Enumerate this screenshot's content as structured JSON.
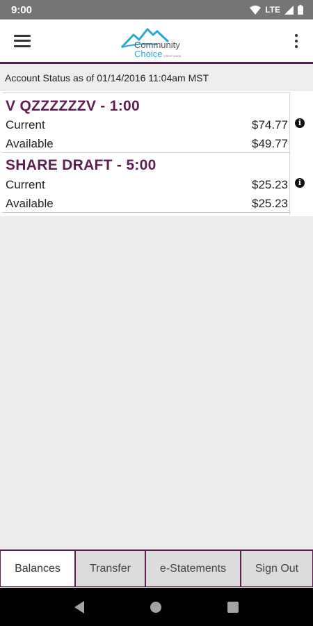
{
  "status_bar": {
    "time": "9:00",
    "network": "LTE"
  },
  "header": {
    "logo_line1": "Community",
    "logo_line2": "Choice",
    "logo_tag": "CREDIT UNION",
    "accent_color": "#5e1e52",
    "logo_color": "#29a8d1"
  },
  "account_status": "Account Status as of 01/14/2016 11:04am MST",
  "accounts": [
    {
      "name": "V QZZZZZZV - 1:00",
      "current_label": "Current",
      "current_value": "$74.77",
      "available_label": "Available",
      "available_value": "$49.77"
    },
    {
      "name": "SHARE DRAFT - 5:00",
      "current_label": "Current",
      "current_value": "$25.23",
      "available_label": "Available",
      "available_value": "$25.23"
    }
  ],
  "tabs": [
    {
      "label": "Balances",
      "active": true
    },
    {
      "label": "Transfer",
      "active": false
    },
    {
      "label": "e-Statements",
      "active": false
    },
    {
      "label": "Sign Out",
      "active": false
    }
  ]
}
